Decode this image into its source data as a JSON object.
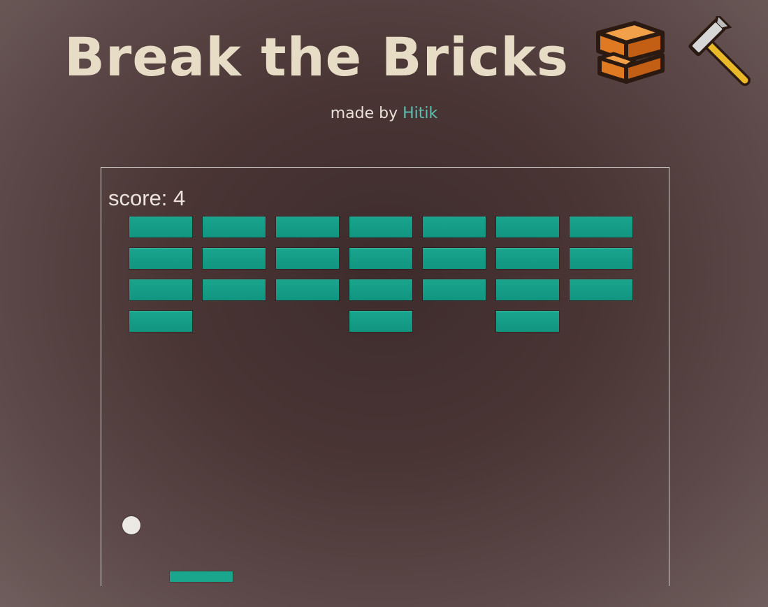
{
  "header": {
    "title": "Break the Bricks",
    "title_icons": [
      "bricks-icon",
      "hammer-icon"
    ],
    "credit_prefix": "made by ",
    "credit_author": "Hitik"
  },
  "game": {
    "score_label": "score: 4",
    "score": 4,
    "brick_grid": {
      "rows": 4,
      "cols": 7,
      "present": [
        [
          1,
          1,
          1,
          1,
          1,
          1,
          1
        ],
        [
          1,
          1,
          1,
          1,
          1,
          1,
          1
        ],
        [
          1,
          1,
          1,
          1,
          1,
          1,
          1
        ],
        [
          1,
          0,
          0,
          1,
          0,
          1,
          0
        ]
      ]
    }
  },
  "colors": {
    "brick": "#1aa58d",
    "paddle": "#1aa58d",
    "ball": "#ece8e4",
    "title": "#e7dcc5",
    "link": "#5fbfb0"
  }
}
